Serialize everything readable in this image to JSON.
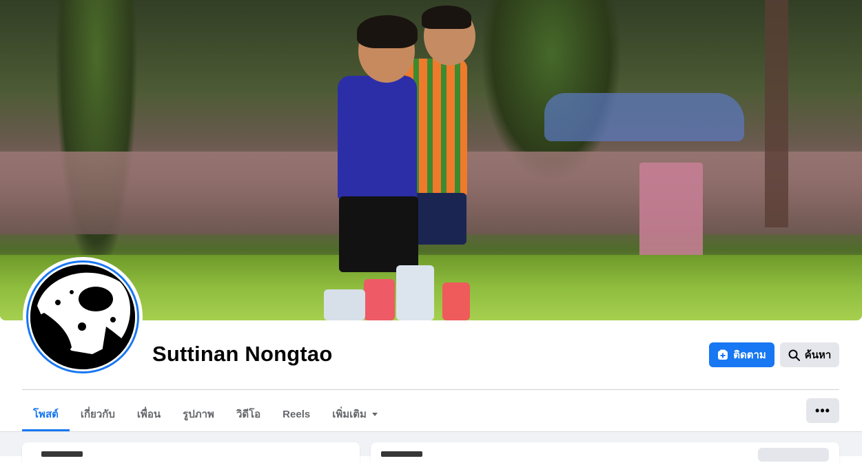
{
  "profile": {
    "name": "Suttinan Nongtao"
  },
  "actions": {
    "follow_label": "ติดตาม",
    "follow_icon": "follow-plus-icon",
    "search_label": "ค้นหา",
    "search_icon": "search-icon",
    "more_label": "•••"
  },
  "tabs": [
    {
      "label": "โพสต์",
      "active": true
    },
    {
      "label": "เกี่ยวกับ",
      "active": false
    },
    {
      "label": "เพื่อน",
      "active": false
    },
    {
      "label": "รูปภาพ",
      "active": false
    },
    {
      "label": "วิดีโอ",
      "active": false
    },
    {
      "label": "Reels",
      "active": false
    },
    {
      "label": "เพิ่มเติม",
      "active": false
    }
  ],
  "colors": {
    "accent": "#1877f2",
    "button_grey": "#e4e6eb",
    "page_bg": "#f0f2f5"
  }
}
